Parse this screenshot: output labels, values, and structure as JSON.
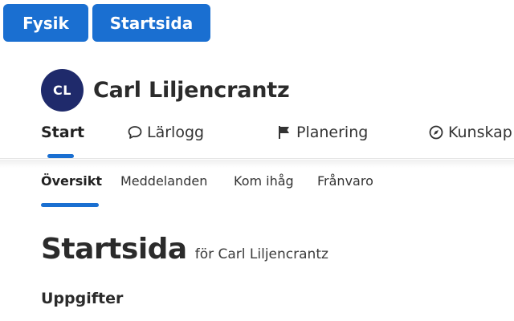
{
  "top_buttons": {
    "subject_label": "Fysik",
    "start_label": "Startsida"
  },
  "profile": {
    "initials": "CL",
    "name": "Carl Liljencrantz"
  },
  "main_nav": {
    "items": [
      {
        "label": "Start",
        "icon": null,
        "active": true
      },
      {
        "label": "Lärlogg",
        "icon": "speech-bubble-icon",
        "active": false
      },
      {
        "label": "Planering",
        "icon": "flag-icon",
        "active": false
      },
      {
        "label": "Kunskap",
        "icon": "compass-icon",
        "active": false
      }
    ]
  },
  "sub_nav": {
    "items": [
      {
        "label": "Översikt",
        "active": true
      },
      {
        "label": "Meddelanden",
        "active": false
      },
      {
        "label": "Kom ihåg",
        "active": false
      },
      {
        "label": "Frånvaro",
        "active": false
      }
    ]
  },
  "page": {
    "title": "Startsida",
    "subtitle": "för Carl Liljencrantz",
    "section_heading": "Uppgifter"
  },
  "colors": {
    "accent": "#1a6fd1",
    "avatar_bg": "#1f2a6b",
    "text": "#2b2b2b"
  }
}
